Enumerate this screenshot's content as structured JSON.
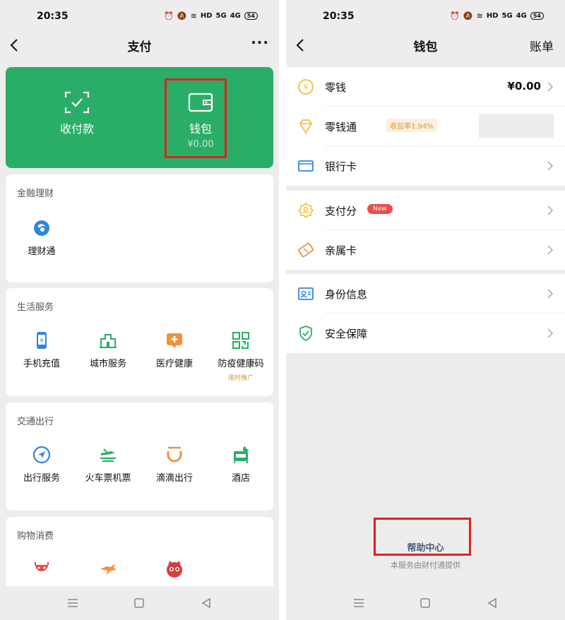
{
  "status": {
    "time": "20:35",
    "battery": "54",
    "hd": "HD",
    "net1": "5G",
    "net2": "4G"
  },
  "left": {
    "title": "支付",
    "more": "···",
    "hero": {
      "pay_label": "收付款",
      "wallet_label": "钱包",
      "wallet_balance": "¥0.00"
    },
    "sections": [
      {
        "title": "金融理财",
        "items": [
          {
            "label": "理财通",
            "icon": "licaitong-icon"
          }
        ]
      },
      {
        "title": "生活服务",
        "items": [
          {
            "label": "手机充值",
            "icon": "phone-recharge-icon"
          },
          {
            "label": "城市服务",
            "icon": "city-service-icon"
          },
          {
            "label": "医疗健康",
            "icon": "medical-icon"
          },
          {
            "label": "防疫健康码",
            "icon": "qr-code-icon",
            "sub": "限时推广"
          }
        ]
      },
      {
        "title": "交通出行",
        "items": [
          {
            "label": "出行服务",
            "icon": "navigation-icon"
          },
          {
            "label": "火车票机票",
            "icon": "train-icon"
          },
          {
            "label": "滴滴出行",
            "icon": "didi-icon"
          },
          {
            "label": "酒店",
            "icon": "hotel-icon"
          }
        ]
      },
      {
        "title": "购物消费",
        "items": [
          {
            "label": "",
            "icon": "meituan-icon"
          },
          {
            "label": "",
            "icon": "kangaroo-icon"
          },
          {
            "label": "",
            "icon": "cat-icon"
          }
        ]
      }
    ]
  },
  "right": {
    "title": "钱包",
    "bill": "账单",
    "groups": [
      [
        {
          "label": "零钱",
          "value": "¥0.00",
          "icon": "change-icon"
        },
        {
          "label": "零钱通",
          "tag": "收益率1.94%",
          "icon": "diamond-icon"
        },
        {
          "label": "银行卡",
          "icon": "bank-card-icon"
        }
      ],
      [
        {
          "label": "支付分",
          "tag": "New",
          "icon": "pay-score-icon"
        },
        {
          "label": "亲属卡",
          "icon": "family-card-icon"
        }
      ],
      [
        {
          "label": "身份信息",
          "icon": "id-info-icon"
        },
        {
          "label": "安全保障",
          "icon": "shield-icon"
        }
      ]
    ],
    "help_center": "帮助中心",
    "provided_by": "本服务由财付通提供"
  },
  "colors": {
    "green": "#2aae67",
    "highlight": "#e02020",
    "accent_yellow": "#f1c232",
    "blue": "#2e86de"
  }
}
